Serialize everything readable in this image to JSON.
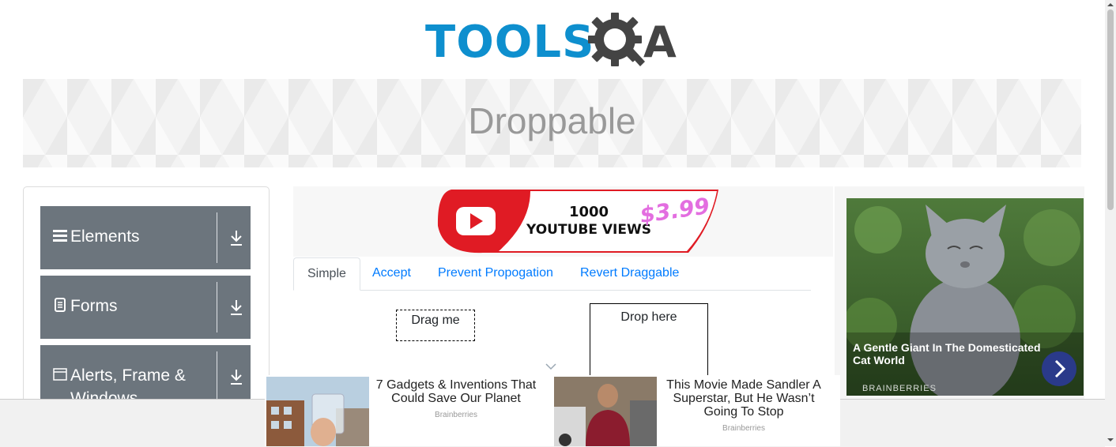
{
  "header": {
    "logo_text": "TOOLS",
    "logo_suffix": "A",
    "logo_icon": "gear-magnifier-icon",
    "colors": {
      "blue": "#0e8fce",
      "dark": "#444444"
    }
  },
  "page": {
    "title": "Droppable"
  },
  "sidebar": {
    "groups": [
      {
        "label": "Elements",
        "icon": "hamburger-icon"
      },
      {
        "label": "Forms",
        "icon": "document-icon"
      },
      {
        "label": "Alerts, Frame & Windows",
        "icon": "window-icon"
      }
    ],
    "colors": {
      "group_bg": "#6c757d"
    }
  },
  "ad_top": {
    "line1": "1000",
    "line2": "YOUTUBE VIEWS",
    "price": "$3.99"
  },
  "tabs": [
    {
      "label": "Simple",
      "active": true
    },
    {
      "label": "Accept",
      "active": false
    },
    {
      "label": "Prevent Propogation",
      "active": false
    },
    {
      "label": "Revert Draggable",
      "active": false
    }
  ],
  "simple": {
    "drag_label": "Drag me",
    "drop_label": "Drop here"
  },
  "ad_right": {
    "caption": "A Gentle Giant In The Domesticated Cat World",
    "source": "BRAINBERRIES"
  },
  "ad_bottom": {
    "items": [
      {
        "title": "7 Gadgets & Inventions That Could Save Our Planet",
        "source": "Brainberries"
      },
      {
        "title": "This Movie Made Sandler A Superstar, But He Wasn’t Going To Stop",
        "source": "Brainberries"
      }
    ]
  }
}
